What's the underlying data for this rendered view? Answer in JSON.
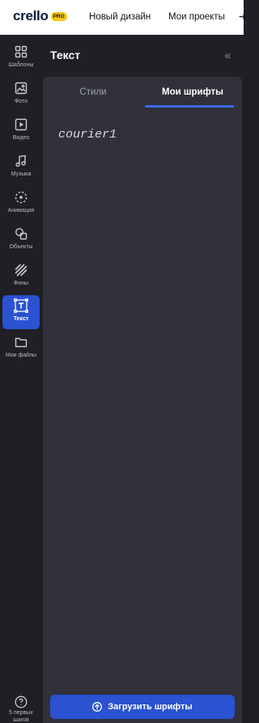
{
  "topbar": {
    "logo": "crello",
    "badge": "PRO",
    "links": [
      "Новый дизайн",
      "Мои проекты"
    ],
    "truncated_arrow": "➔"
  },
  "rail": {
    "items": [
      {
        "label": "Шаблоны",
        "icon": "grid-icon"
      },
      {
        "label": "Фото",
        "icon": "photo-icon"
      },
      {
        "label": "Видео",
        "icon": "video-icon"
      },
      {
        "label": "Музыка",
        "icon": "music-icon"
      },
      {
        "label": "Анимация",
        "icon": "animation-icon"
      },
      {
        "label": "Объекты",
        "icon": "objects-icon"
      },
      {
        "label": "Фоны",
        "icon": "backgrounds-icon"
      },
      {
        "label": "Текст",
        "icon": "text-icon",
        "active": true
      },
      {
        "label": "Мои файлы",
        "icon": "folder-icon"
      }
    ],
    "help": {
      "icon": "question-icon",
      "line1": "5 первых",
      "line2": "шагов"
    }
  },
  "panel": {
    "title": "Текст",
    "collapse_icon": "«",
    "tabs": [
      {
        "label": "Стили",
        "active": false
      },
      {
        "label": "Мои шрифты",
        "active": true
      }
    ],
    "fonts": [
      "courier1"
    ],
    "upload_button": "Загрузить шрифты"
  },
  "colors": {
    "accent": "#2a52d1",
    "rail_bg": "#1f1f24",
    "panel_bg": "#30313a",
    "pro_badge": "#f7c61a"
  }
}
